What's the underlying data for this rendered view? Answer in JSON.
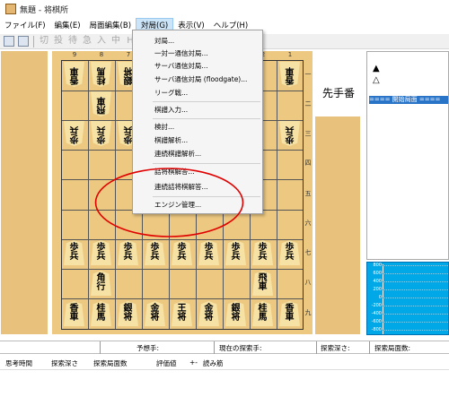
{
  "window": {
    "title": "無題 - 将棋所"
  },
  "menubar": {
    "items": [
      "ファイル(F)",
      "編集(E)",
      "局面編集(B)",
      "対局(G)",
      "表示(V)",
      "ヘルプ(H)"
    ],
    "active": "対局(G)"
  },
  "toolbar": {
    "buttons": [
      "切",
      "投",
      "待",
      "急",
      "入",
      "中",
      "H"
    ]
  },
  "dropdown": {
    "items": [
      "対局...",
      "一対一通信対局...",
      "サーバ通信対局...",
      "サーバ通信対局 (floodgate)...",
      "リーグ戦...",
      "棋譜入力...",
      "検討...",
      "棋譜解析...",
      "連続棋譜解析...",
      "詰将棋解答...",
      "連続詰将棋解答...",
      "エンジン管理..."
    ]
  },
  "board": {
    "file_labels": [
      "9",
      "8",
      "7",
      "6",
      "5",
      "4",
      "3",
      "2",
      "1"
    ],
    "rank_labels": [
      "一",
      "二",
      "三",
      "四",
      "五",
      "六",
      "七",
      "八",
      "九"
    ],
    "pieces": {
      "gote_r1": [
        [
          "香",
          "車"
        ],
        [
          "桂",
          "馬"
        ],
        [
          "銀",
          "将"
        ],
        [
          "金",
          "将"
        ],
        [
          "玉",
          "将"
        ],
        [
          "金",
          "将"
        ],
        [
          "銀",
          "将"
        ],
        [
          "桂",
          "馬"
        ],
        [
          "香",
          "車"
        ]
      ],
      "gote_r2_right": [
        "飛",
        "車"
      ],
      "gote_r2_left": [
        "角",
        "行"
      ],
      "gote_pawn": [
        "歩",
        "兵"
      ],
      "sente_pawn": [
        "歩",
        "兵"
      ],
      "sente_r8_left": [
        "角",
        "行"
      ],
      "sente_r8_right": [
        "飛",
        "車"
      ],
      "sente_r9": [
        [
          "香",
          "車"
        ],
        [
          "桂",
          "馬"
        ],
        [
          "銀",
          "将"
        ],
        [
          "金",
          "将"
        ],
        [
          "王",
          "将"
        ],
        [
          "金",
          "将"
        ],
        [
          "銀",
          "将"
        ],
        [
          "桂",
          "馬"
        ],
        [
          "香",
          "車"
        ]
      ]
    }
  },
  "sente": {
    "label": "先手番"
  },
  "kifu": {
    "up_mark": "▲",
    "down_mark": "△",
    "start_row": "==== 開始局面 ===="
  },
  "graph": {
    "ticks": [
      "800",
      "600",
      "400",
      "200",
      "0",
      "-200",
      "-400",
      "-600",
      "-800"
    ]
  },
  "status1": {
    "yosou": "予想手:",
    "genzai": "現在の探索手:",
    "tansaku_fukasa": "探索深さ:",
    "tansaku_kyokumen": "探索局面数:"
  },
  "status2": {
    "thinking_time": "思考時間",
    "depth": "探索深さ",
    "nodes": "探索局面数",
    "eval": "評価値",
    "arrow": "+-",
    "pv": "読み筋"
  },
  "colors": {
    "board": "#ecc880",
    "komadai": "#e8c27c",
    "highlight": "#2a74c8",
    "graph_bg": "#00a8e8",
    "annotation": "#e00000"
  }
}
